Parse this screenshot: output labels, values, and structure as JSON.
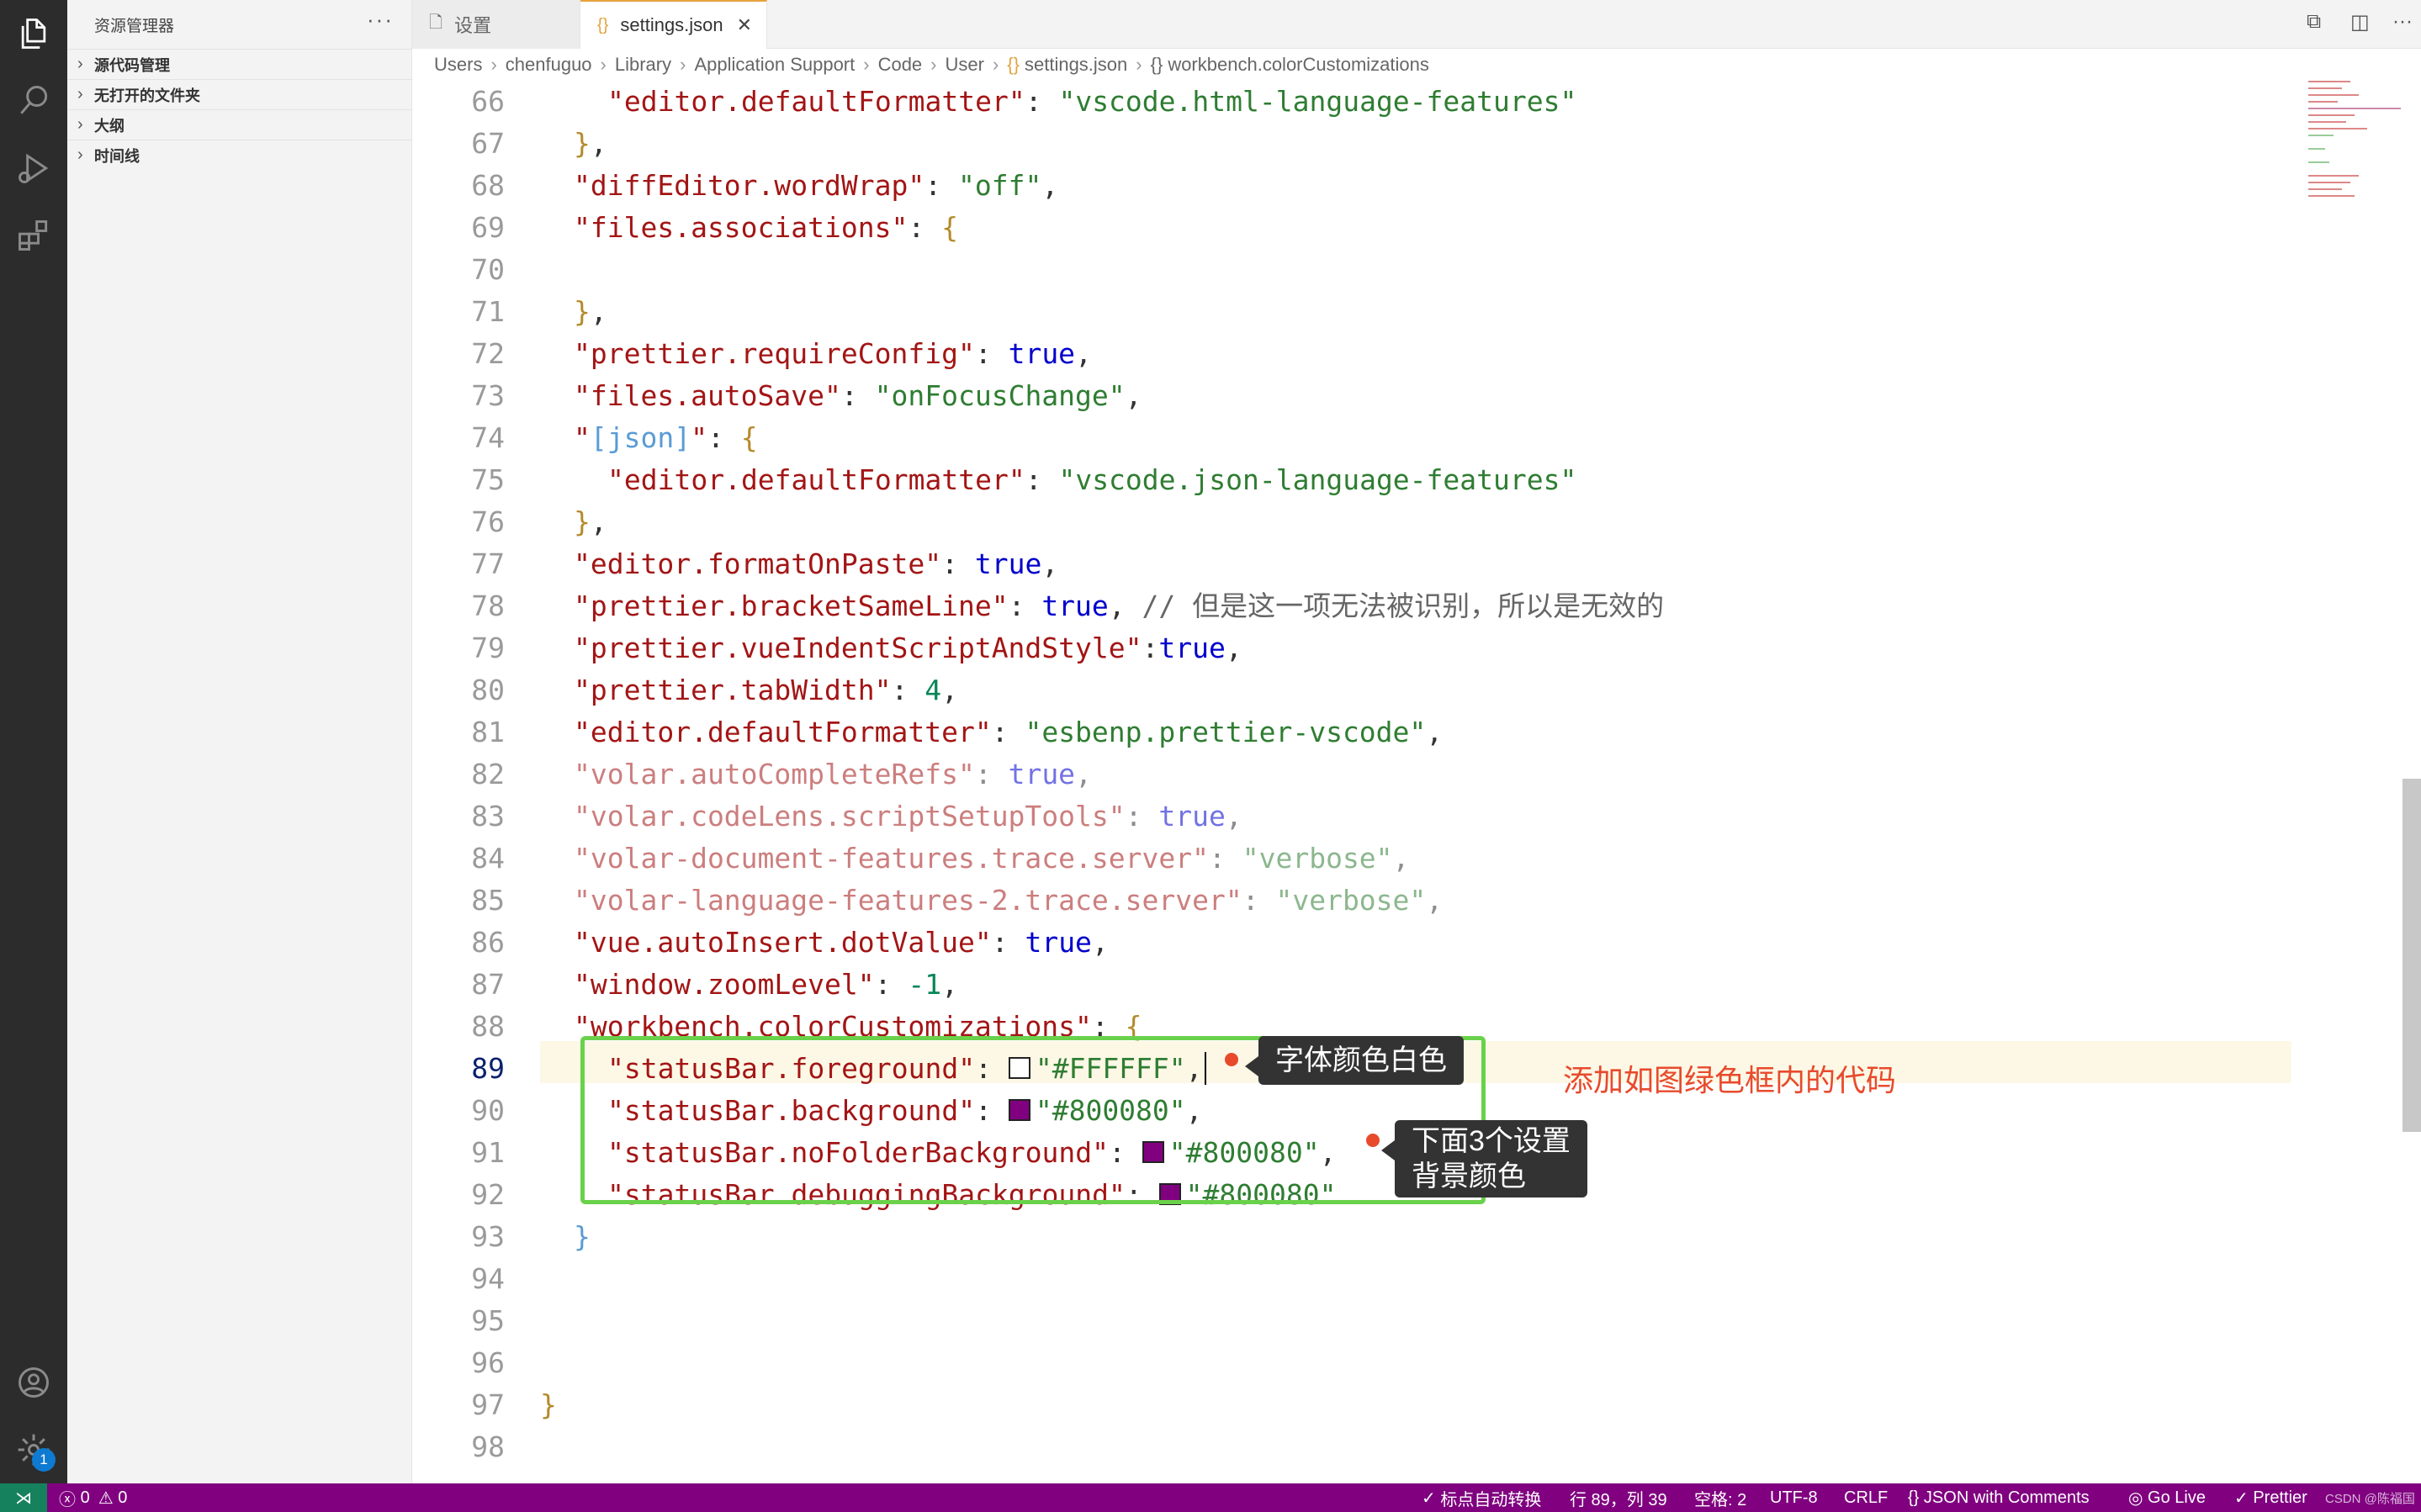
{
  "sidebar": {
    "title": "资源管理器",
    "more": "···",
    "sections": [
      "源代码管理",
      "无打开的文件夹",
      "大纲",
      "时间线"
    ]
  },
  "tabs": [
    {
      "label": "设置",
      "icon": "file-icon"
    },
    {
      "label": "settings.json",
      "icon": "json-braces-icon"
    }
  ],
  "breadcrumb": [
    "Users",
    "chenfuguo",
    "Library",
    "Application Support",
    "Code",
    "User",
    "settings.json",
    "workbench.colorCustomizations"
  ],
  "editor": {
    "current_line": 89,
    "line_numbers": [
      "66",
      "67",
      "68",
      "69",
      "70",
      "71",
      "72",
      "73",
      "74",
      "75",
      "76",
      "77",
      "78",
      "79",
      "80",
      "81",
      "82",
      "83",
      "84",
      "85",
      "86",
      "87",
      "88",
      "89",
      "90",
      "91",
      "92",
      "93",
      "94",
      "95",
      "96",
      "97",
      "98"
    ],
    "lines": {
      "l66": {
        "key": "\"editor.defaultFormatter\"",
        "value": "\"vscode.html-language-features\""
      },
      "l68": {
        "key": "\"diffEditor.wordWrap\"",
        "value": "\"off\""
      },
      "l69": {
        "key": "\"files.associations\""
      },
      "l72": {
        "key": "\"prettier.requireConfig\"",
        "value": "true"
      },
      "l73": {
        "key": "\"files.autoSave\"",
        "value": "\"onFocusChange\""
      },
      "l74": {
        "key_open": "\"",
        "key_inner": "[json]",
        "key_close": "\""
      },
      "l75": {
        "key": "\"editor.defaultFormatter\"",
        "value": "\"vscode.json-language-features\""
      },
      "l77": {
        "key": "\"editor.formatOnPaste\"",
        "value": "true"
      },
      "l78": {
        "key": "\"prettier.bracketSameLine\"",
        "value": "true",
        "comment": "// 但是这一项无法被识别，所以是无效的"
      },
      "l79": {
        "key": "\"prettier.vueIndentScriptAndStyle\"",
        "value": "true"
      },
      "l80": {
        "key": "\"prettier.tabWidth\"",
        "value": "4"
      },
      "l81": {
        "key": "\"editor.defaultFormatter\"",
        "value": "\"esbenp.prettier-vscode\""
      },
      "l82": {
        "key": "\"volar.autoCompleteRefs\"",
        "value": "true"
      },
      "l83": {
        "key": "\"volar.codeLens.scriptSetupTools\"",
        "value": "true"
      },
      "l84": {
        "key": "\"volar-document-features.trace.server\"",
        "value": "\"verbose\""
      },
      "l85": {
        "key": "\"volar-language-features-2.trace.server\"",
        "value": "\"verbose\""
      },
      "l86": {
        "key": "\"vue.autoInsert.dotValue\"",
        "value": "true"
      },
      "l87": {
        "key": "\"window.zoomLevel\"",
        "value": "-1"
      },
      "l88": {
        "key": "\"workbench.colorCustomizations\""
      },
      "l89": {
        "key": "\"statusBar.foreground\"",
        "value": "\"#FFFFFF\"",
        "swatch": "#FFFFFF"
      },
      "l90": {
        "key": "\"statusBar.background\"",
        "value": "\"#800080\"",
        "swatch": "#800080"
      },
      "l91": {
        "key": "\"statusBar.noFolderBackground\"",
        "value": "\"#800080\"",
        "swatch": "#800080"
      },
      "l92": {
        "key": "\"statusBar.debuggingBackground\"",
        "value": "\"#800080\"",
        "swatch": "#800080"
      }
    }
  },
  "annotations": {
    "tip1": "字体颜色白色",
    "tip2_line1": "下面3个设置",
    "tip2_line2": "背景颜色",
    "note": "添加如图绿色框内的代码"
  },
  "statusbar": {
    "errors": "0",
    "warnings": "0",
    "punct": "标点自动转换",
    "position": "行 89，列 39",
    "spaces": "空格: 2",
    "encoding": "UTF-8",
    "eol": "CRLF",
    "language": "JSON with Comments",
    "golive": "Go Live",
    "prettier": "Prettier",
    "watermark": "CSDN @陈福国"
  },
  "colors": {
    "statusbar_bg": "#800080",
    "annotation_red": "#e84a2c",
    "highlight_box": "#6ad14b"
  }
}
